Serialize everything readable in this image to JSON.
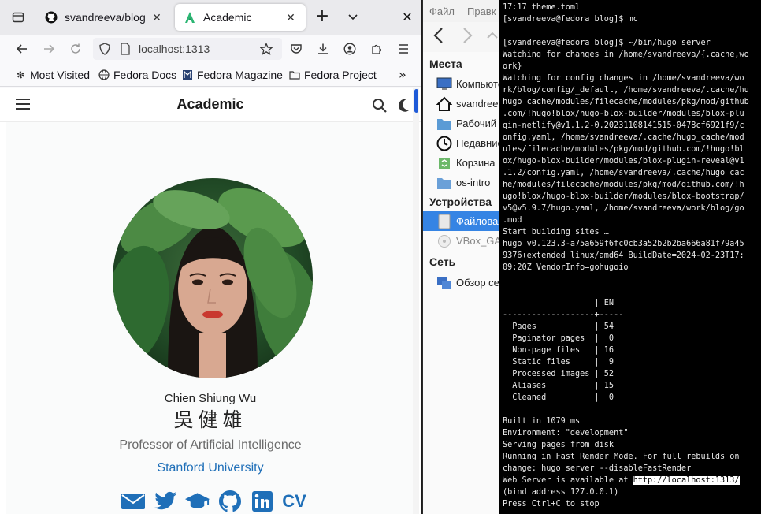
{
  "browser": {
    "tabs": [
      {
        "title": "svandreeva/blog",
        "icon": "github-icon",
        "active": false
      },
      {
        "title": "Academic",
        "icon": "academic-icon",
        "active": true
      }
    ],
    "new_tab": "+",
    "close": "✕",
    "url": "localhost:1313",
    "bookmarks": [
      {
        "label": "Most Visited",
        "icon": "gear-icon"
      },
      {
        "label": "Fedora Docs",
        "icon": "globe-icon"
      },
      {
        "label": "Fedora Magazine",
        "icon": "magazine-icon"
      },
      {
        "label": "Fedora Project",
        "icon": "folder-icon"
      }
    ],
    "bookmarks_overflow": "»"
  },
  "site": {
    "title": "Academic",
    "name": "Chien Shiung Wu",
    "name_cn": "吳健雄",
    "role": "Professor of Artificial Intelligence",
    "organization": "Stanford University",
    "socials": [
      "email-icon",
      "twitter-icon",
      "scholar-icon",
      "github-icon",
      "linkedin-icon"
    ],
    "cv": "CV",
    "accent": "#1f6fb8"
  },
  "filemanager": {
    "menu": [
      "Файл",
      "Правк"
    ],
    "places_header": "Места",
    "places": [
      {
        "label": "Компьютер",
        "icon": "computer-icon"
      },
      {
        "label": "svandreeva",
        "icon": "home-icon"
      },
      {
        "label": "Рабочий стол",
        "icon": "desktop-folder-icon"
      },
      {
        "label": "Недавние",
        "icon": "recent-icon"
      },
      {
        "label": "Корзина",
        "icon": "trash-icon"
      },
      {
        "label": "os-intro",
        "icon": "folder-icon"
      }
    ],
    "devices_header": "Устройства",
    "devices": [
      {
        "label": "Файловая система",
        "icon": "drive-icon",
        "selected": true
      },
      {
        "label": "VBox_GAs",
        "icon": "disc-icon",
        "selected": false
      }
    ],
    "network_header": "Сеть",
    "network": [
      {
        "label": "Обзор сети",
        "icon": "network-icon"
      }
    ],
    "selection_color": "#3584e4"
  },
  "terminal": {
    "lines": [
      "17:17 theme.toml",
      "[svandreeva@fedora blog]$ mc",
      "",
      "[svandreeva@fedora blog]$ ~/bin/hugo server",
      "Watching for changes in /home/svandreeva/{.cache,wo",
      "ork}",
      "Watching for config changes in /home/svandreeva/wo",
      "rk/blog/config/_default, /home/svandreeva/.cache/hu",
      "hugo_cache/modules/filecache/modules/pkg/mod/github",
      ".com/!hugo!blox/hugo-blox-builder/modules/blox-plu",
      "gin-netlify@v1.1.2-0.20231108141515-0478cf6921f9/c",
      "onfig.yaml, /home/svandreeva/.cache/hugo_cache/mod",
      "ules/filecache/modules/pkg/mod/github.com/!hugo!bl",
      "ox/hugo-blox-builder/modules/blox-plugin-reveal@v1",
      ".1.2/config.yaml, /home/svandreeva/.cache/hugo_cac",
      "he/modules/filecache/modules/pkg/mod/github.com/!h",
      "ugo!blox/hugo-blox-builder/modules/blox-bootstrap/",
      "v5@v5.9.7/hugo.yaml, /home/svandreeva/work/blog/go",
      ".mod",
      "Start building sites …",
      "hugo v0.123.3-a75a659f6fc0cb3a52b2b2ba666a81f79a45",
      "9376+extended linux/amd64 BuildDate=2024-02-23T17:",
      "09:20Z VendorInfo=gohugoio",
      "",
      "",
      "                   | EN",
      "-------------------+-----",
      "  Pages            | 54",
      "  Paginator pages  |  0",
      "  Non-page files   | 16",
      "  Static files     |  9",
      "  Processed images | 52",
      "  Aliases          | 15",
      "  Cleaned          |  0",
      "",
      "Built in 1079 ms",
      "Environment: \"development\"",
      "Serving pages from disk",
      "Running in Fast Render Mode. For full rebuilds on",
      "change: hugo server --disableFastRender",
      "Web Server is available at ",
      "(bind address 127.0.0.1)",
      "Press Ctrl+C to stop"
    ],
    "server_url": "http://localhost:1313/"
  }
}
